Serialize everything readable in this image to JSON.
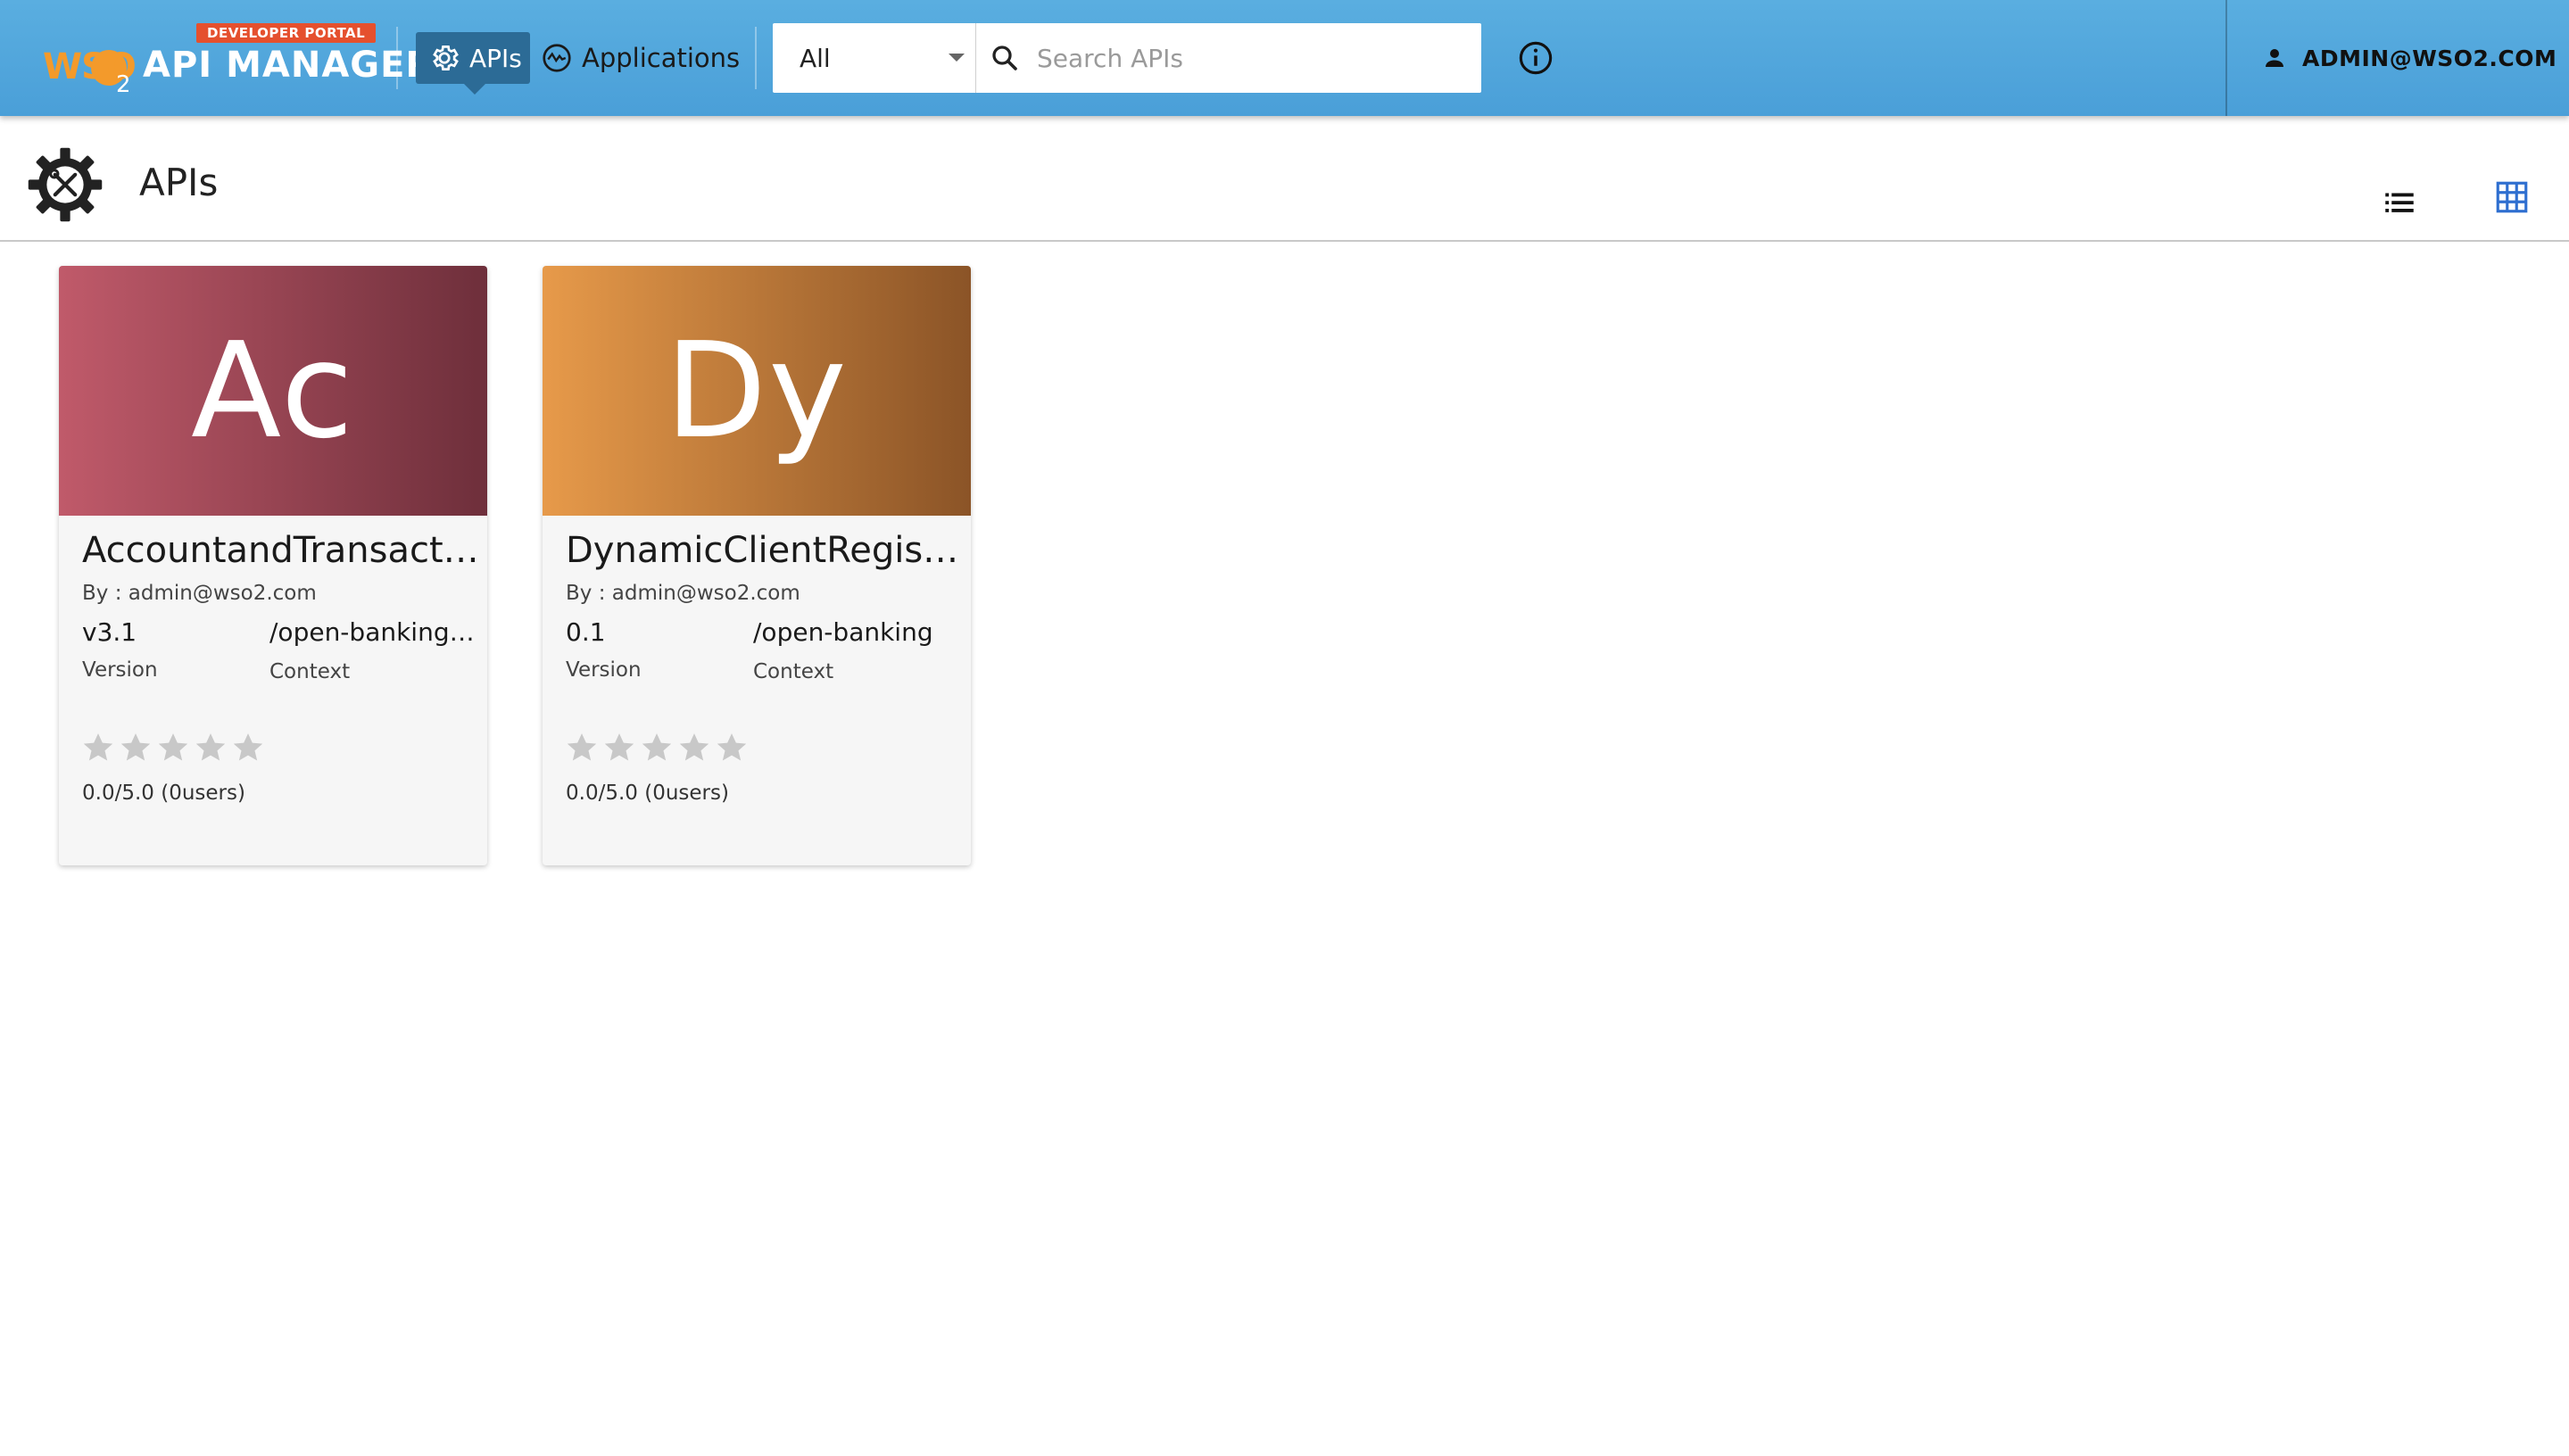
{
  "header": {
    "badge": "DEVELOPER PORTAL",
    "brand": "WSO",
    "brand_sub": "2",
    "product": "API MANAGER",
    "nav": {
      "apis_label": "APIs",
      "applications_label": "Applications"
    },
    "search": {
      "scope_value": "All",
      "placeholder": "Search APIs"
    },
    "user": "ADMIN@WSO2.COM"
  },
  "page": {
    "title": "APIs"
  },
  "apis": [
    {
      "thumb_text": "Ac",
      "name": "AccountandTransactionAPI",
      "by": "By : admin@wso2.com",
      "version": "v3.1",
      "version_label": "Version",
      "context": "/open-banking/{version}/aisp",
      "context_label": "Context",
      "rating": "0.0/5.0 (0users)",
      "rating_value": 0,
      "rating_max": 5,
      "colors": [
        "#c05a6a",
        "#6e2f3b"
      ]
    },
    {
      "thumb_text": "Dy",
      "name": "DynamicClientRegistrationAPI",
      "by": "By : admin@wso2.com",
      "version": "0.1",
      "version_label": "Version",
      "context": "/open-banking",
      "context_label": "Context",
      "rating": "0.0/5.0 (0users)",
      "rating_value": 0,
      "rating_max": 5,
      "colors": [
        "#e79a4a",
        "#8b5427"
      ]
    }
  ],
  "colors": {
    "header": "#4a9fd8",
    "nav_active": "#2c6b96",
    "badge": "#e5502e",
    "grid_icon": "#2f6fd0",
    "star_empty": "#c8c8c8"
  }
}
